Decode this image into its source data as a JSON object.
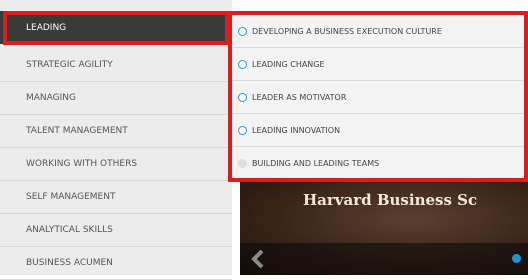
{
  "left_menu": {
    "items": [
      {
        "label": "LEADING"
      },
      {
        "label": "STRATEGIC AGILITY"
      },
      {
        "label": "MANAGING"
      },
      {
        "label": "TALENT MANAGEMENT"
      },
      {
        "label": "WORKING WITH OTHERS"
      },
      {
        "label": "SELF MANAGEMENT"
      },
      {
        "label": "ANALYTICAL SKILLS"
      },
      {
        "label": "BUSINESS ACUMEN"
      }
    ],
    "active_index": 0
  },
  "submenu": {
    "items": [
      {
        "label": "DEVELOPING A BUSINESS EXECUTION CULTURE",
        "icon": "radio-empty-icon"
      },
      {
        "label": "LEADING CHANGE",
        "icon": "radio-empty-icon"
      },
      {
        "label": "LEADER AS MOTIVATOR",
        "icon": "radio-empty-icon"
      },
      {
        "label": "LEADING INNOVATION",
        "icon": "radio-empty-icon"
      },
      {
        "label": "BUILDING AND LEADING TEAMS",
        "icon": "radio-filled-icon"
      }
    ]
  },
  "banner": {
    "title": "Harvard Business Sc",
    "prev_icon": "chevron-left-icon",
    "dot_icon": "carousel-dot-icon"
  },
  "colors": {
    "highlight": "#e01b1b",
    "accent": "#1e95d4",
    "active_bg": "#3a3a3a"
  }
}
